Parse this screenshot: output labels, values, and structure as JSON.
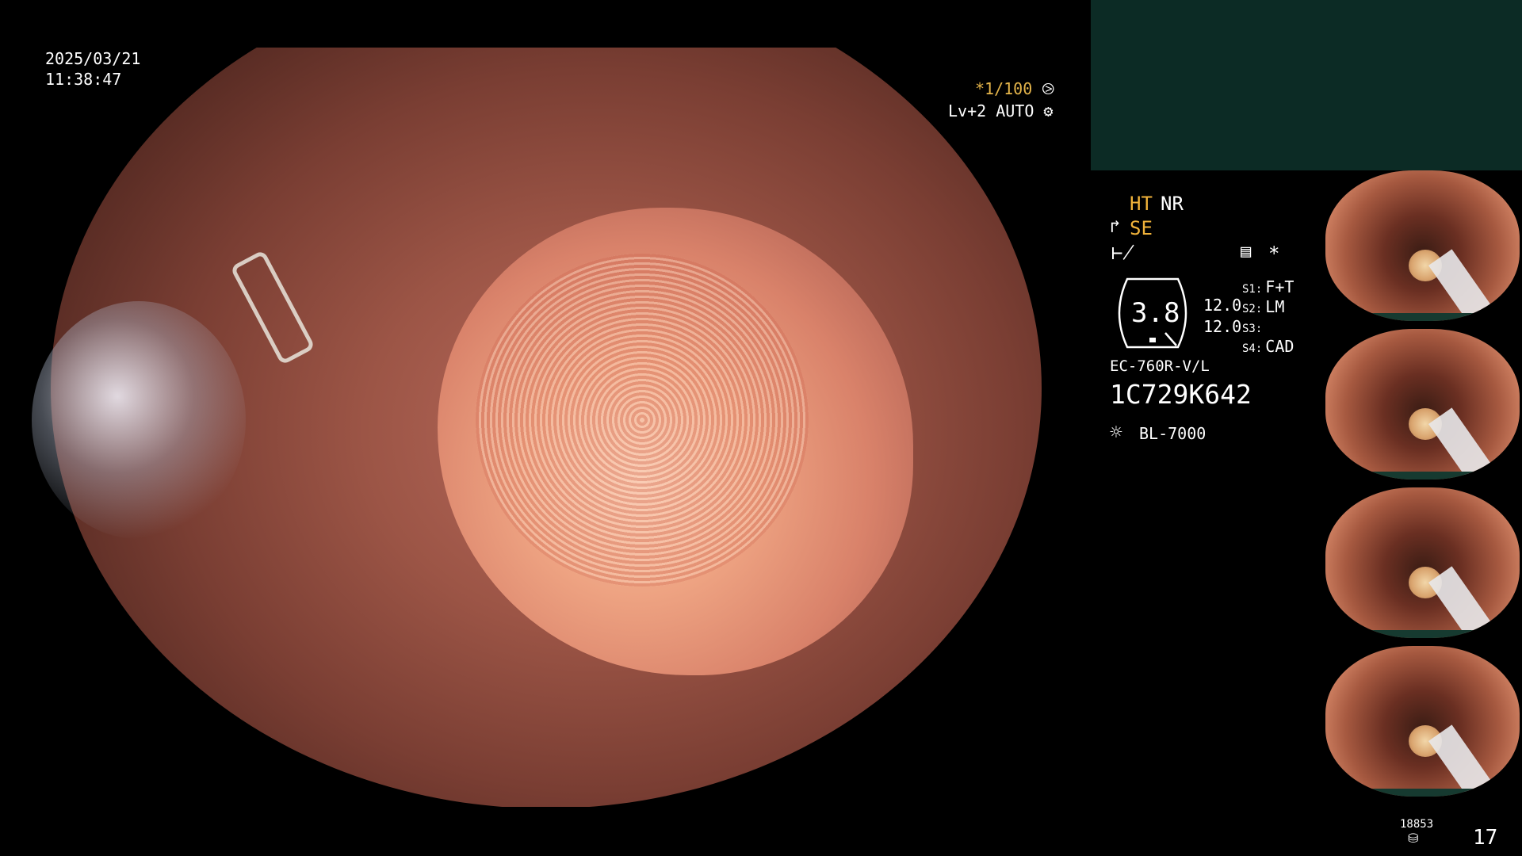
{
  "overlay": {
    "date": "2025/03/21",
    "time": "11:38:47",
    "shutter": "*1/100",
    "level": "Lv+2 AUTO"
  },
  "status": {
    "ht": "HT",
    "nr": "NR",
    "se": "SE",
    "asterisk": "*",
    "hex_value": "3.8",
    "value_1": "12.0",
    "value_2": "12.0",
    "s1_key": "S1:",
    "s1_val": "F+T",
    "s2_key": "S2:",
    "s2_val": "LM",
    "s3_key": "S3:",
    "s3_val": "",
    "s4_key": "S4:",
    "s4_val": "CAD",
    "scope_model": "EC-760R-V/L",
    "serial": "1C729K642",
    "lamp": "BL-7000"
  },
  "footer": {
    "disk_count": "18853",
    "page_number": "17"
  },
  "icons": {
    "shutter_icon": "aperture-icon",
    "level_icon": "gear-icon",
    "se_icon": "structure-enhance-icon",
    "f_icon": "filter-icon",
    "doc_icon": "document-icon",
    "lamp_icon": "sun-icon",
    "disk_icon": "disk-icon"
  },
  "colors": {
    "accent_yellow": "#f0b23a",
    "teal_panel": "#0c2b25"
  }
}
